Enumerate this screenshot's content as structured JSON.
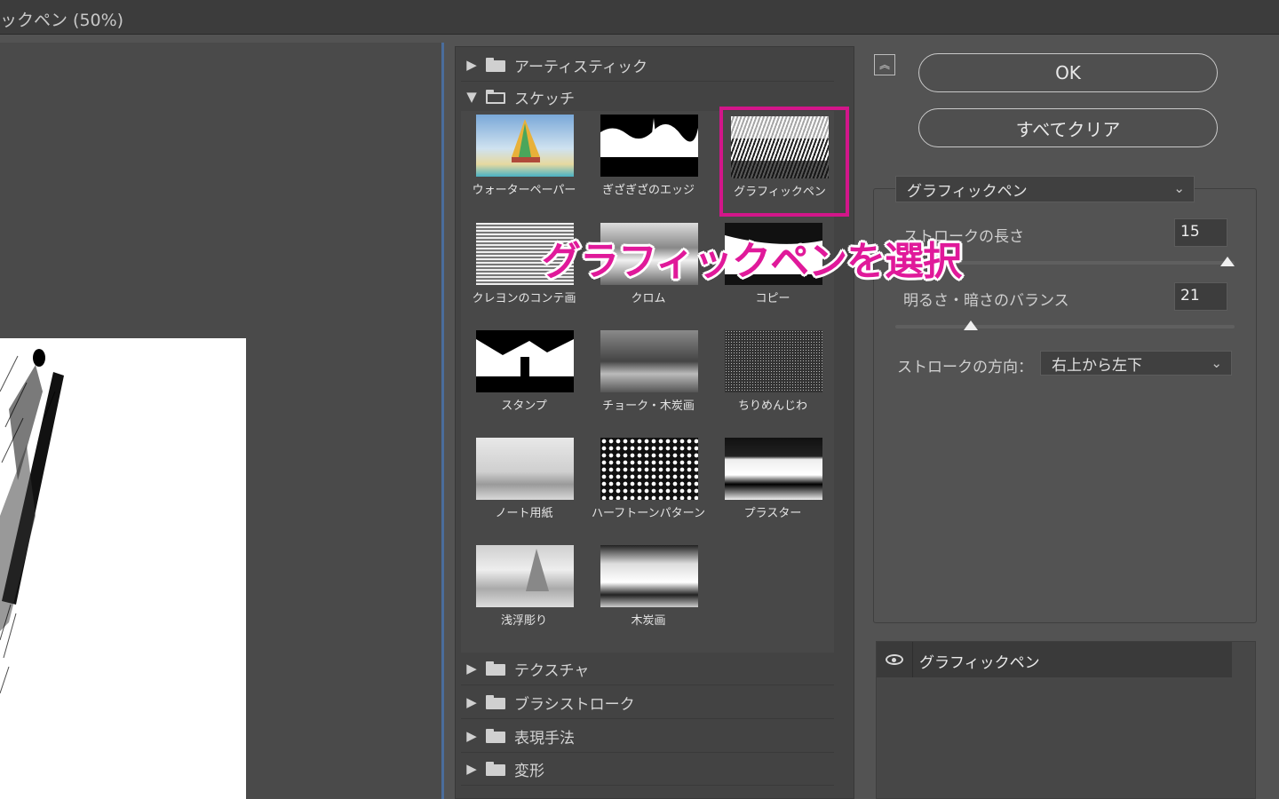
{
  "window": {
    "title": "ックペン (50%)"
  },
  "gallery": {
    "categories_top": [
      {
        "label": "アーティスティック",
        "expanded": false
      },
      {
        "label": "スケッチ",
        "expanded": true
      }
    ],
    "filters": [
      {
        "label": "ウォーターペーパー"
      },
      {
        "label": "ぎざぎざのエッジ"
      },
      {
        "label": "グラフィックペン",
        "selected": true
      },
      {
        "label": "クレヨンのコンテ画"
      },
      {
        "label": "クロム"
      },
      {
        "label": "コピー"
      },
      {
        "label": "スタンプ"
      },
      {
        "label": "チョーク・木炭画"
      },
      {
        "label": "ちりめんじわ"
      },
      {
        "label": "ノート用紙"
      },
      {
        "label": "ハーフトーンパターン"
      },
      {
        "label": "プラスター"
      },
      {
        "label": "浅浮彫り"
      },
      {
        "label": "木炭画"
      }
    ],
    "categories_bottom": [
      {
        "label": "テクスチャ"
      },
      {
        "label": "ブラシストローク"
      },
      {
        "label": "表現手法"
      },
      {
        "label": "変形"
      }
    ]
  },
  "buttons": {
    "ok": "OK",
    "clear_all": "すべてクリア"
  },
  "settings": {
    "filter_select": "グラフィックペン",
    "stroke_length": {
      "label": "ストロークの長さ",
      "value": "15",
      "fraction": 1.0
    },
    "balance": {
      "label": "明るさ・暗さのバランス",
      "value": "21",
      "fraction": 0.21
    },
    "direction": {
      "label": "ストロークの方向：",
      "value": "右上から左下"
    }
  },
  "layers": [
    {
      "name": "グラフィックペン"
    }
  ],
  "annotation": "グラフィックペンを選択",
  "colors": {
    "highlight": "#d2168a",
    "accent": "#4a6d9c"
  }
}
